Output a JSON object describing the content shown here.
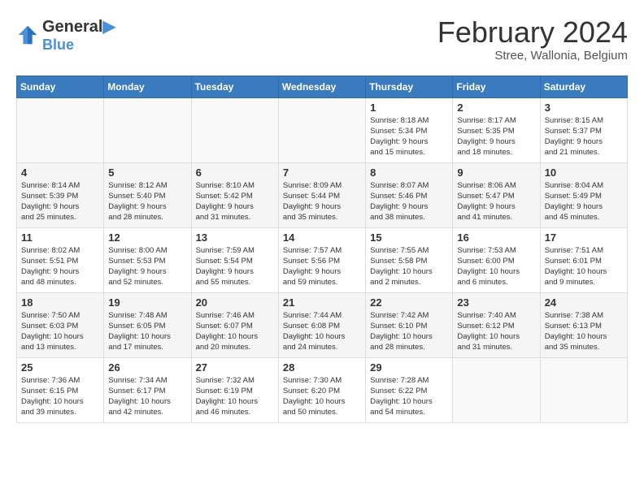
{
  "header": {
    "logo_line1": "General",
    "logo_line2": "Blue",
    "month": "February 2024",
    "location": "Stree, Wallonia, Belgium"
  },
  "weekdays": [
    "Sunday",
    "Monday",
    "Tuesday",
    "Wednesday",
    "Thursday",
    "Friday",
    "Saturday"
  ],
  "weeks": [
    [
      {
        "day": "",
        "info": ""
      },
      {
        "day": "",
        "info": ""
      },
      {
        "day": "",
        "info": ""
      },
      {
        "day": "",
        "info": ""
      },
      {
        "day": "1",
        "info": "Sunrise: 8:18 AM\nSunset: 5:34 PM\nDaylight: 9 hours\nand 15 minutes."
      },
      {
        "day": "2",
        "info": "Sunrise: 8:17 AM\nSunset: 5:35 PM\nDaylight: 9 hours\nand 18 minutes."
      },
      {
        "day": "3",
        "info": "Sunrise: 8:15 AM\nSunset: 5:37 PM\nDaylight: 9 hours\nand 21 minutes."
      }
    ],
    [
      {
        "day": "4",
        "info": "Sunrise: 8:14 AM\nSunset: 5:39 PM\nDaylight: 9 hours\nand 25 minutes."
      },
      {
        "day": "5",
        "info": "Sunrise: 8:12 AM\nSunset: 5:40 PM\nDaylight: 9 hours\nand 28 minutes."
      },
      {
        "day": "6",
        "info": "Sunrise: 8:10 AM\nSunset: 5:42 PM\nDaylight: 9 hours\nand 31 minutes."
      },
      {
        "day": "7",
        "info": "Sunrise: 8:09 AM\nSunset: 5:44 PM\nDaylight: 9 hours\nand 35 minutes."
      },
      {
        "day": "8",
        "info": "Sunrise: 8:07 AM\nSunset: 5:46 PM\nDaylight: 9 hours\nand 38 minutes."
      },
      {
        "day": "9",
        "info": "Sunrise: 8:06 AM\nSunset: 5:47 PM\nDaylight: 9 hours\nand 41 minutes."
      },
      {
        "day": "10",
        "info": "Sunrise: 8:04 AM\nSunset: 5:49 PM\nDaylight: 9 hours\nand 45 minutes."
      }
    ],
    [
      {
        "day": "11",
        "info": "Sunrise: 8:02 AM\nSunset: 5:51 PM\nDaylight: 9 hours\nand 48 minutes."
      },
      {
        "day": "12",
        "info": "Sunrise: 8:00 AM\nSunset: 5:53 PM\nDaylight: 9 hours\nand 52 minutes."
      },
      {
        "day": "13",
        "info": "Sunrise: 7:59 AM\nSunset: 5:54 PM\nDaylight: 9 hours\nand 55 minutes."
      },
      {
        "day": "14",
        "info": "Sunrise: 7:57 AM\nSunset: 5:56 PM\nDaylight: 9 hours\nand 59 minutes."
      },
      {
        "day": "15",
        "info": "Sunrise: 7:55 AM\nSunset: 5:58 PM\nDaylight: 10 hours\nand 2 minutes."
      },
      {
        "day": "16",
        "info": "Sunrise: 7:53 AM\nSunset: 6:00 PM\nDaylight: 10 hours\nand 6 minutes."
      },
      {
        "day": "17",
        "info": "Sunrise: 7:51 AM\nSunset: 6:01 PM\nDaylight: 10 hours\nand 9 minutes."
      }
    ],
    [
      {
        "day": "18",
        "info": "Sunrise: 7:50 AM\nSunset: 6:03 PM\nDaylight: 10 hours\nand 13 minutes."
      },
      {
        "day": "19",
        "info": "Sunrise: 7:48 AM\nSunset: 6:05 PM\nDaylight: 10 hours\nand 17 minutes."
      },
      {
        "day": "20",
        "info": "Sunrise: 7:46 AM\nSunset: 6:07 PM\nDaylight: 10 hours\nand 20 minutes."
      },
      {
        "day": "21",
        "info": "Sunrise: 7:44 AM\nSunset: 6:08 PM\nDaylight: 10 hours\nand 24 minutes."
      },
      {
        "day": "22",
        "info": "Sunrise: 7:42 AM\nSunset: 6:10 PM\nDaylight: 10 hours\nand 28 minutes."
      },
      {
        "day": "23",
        "info": "Sunrise: 7:40 AM\nSunset: 6:12 PM\nDaylight: 10 hours\nand 31 minutes."
      },
      {
        "day": "24",
        "info": "Sunrise: 7:38 AM\nSunset: 6:13 PM\nDaylight: 10 hours\nand 35 minutes."
      }
    ],
    [
      {
        "day": "25",
        "info": "Sunrise: 7:36 AM\nSunset: 6:15 PM\nDaylight: 10 hours\nand 39 minutes."
      },
      {
        "day": "26",
        "info": "Sunrise: 7:34 AM\nSunset: 6:17 PM\nDaylight: 10 hours\nand 42 minutes."
      },
      {
        "day": "27",
        "info": "Sunrise: 7:32 AM\nSunset: 6:19 PM\nDaylight: 10 hours\nand 46 minutes."
      },
      {
        "day": "28",
        "info": "Sunrise: 7:30 AM\nSunset: 6:20 PM\nDaylight: 10 hours\nand 50 minutes."
      },
      {
        "day": "29",
        "info": "Sunrise: 7:28 AM\nSunset: 6:22 PM\nDaylight: 10 hours\nand 54 minutes."
      },
      {
        "day": "",
        "info": ""
      },
      {
        "day": "",
        "info": ""
      }
    ]
  ]
}
